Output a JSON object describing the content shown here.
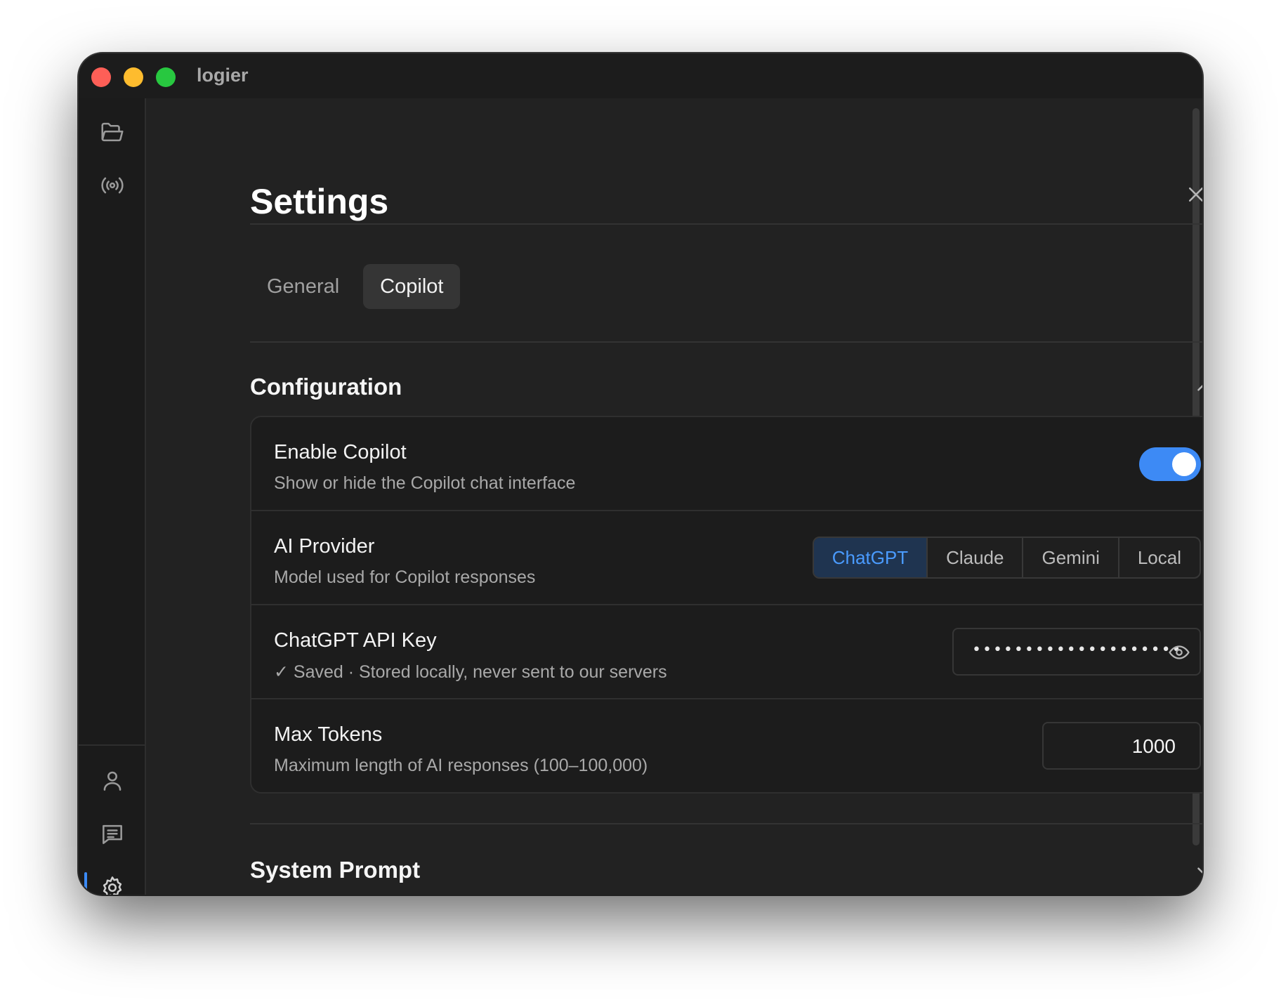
{
  "window": {
    "title": "logier"
  },
  "sidebar": {
    "top_items": [
      {
        "icon": "folder-open-icon"
      },
      {
        "icon": "broadcast-icon"
      }
    ],
    "bottom_items": [
      {
        "icon": "user-icon"
      },
      {
        "icon": "message-icon"
      },
      {
        "icon": "gear-icon",
        "active": true
      }
    ]
  },
  "settings": {
    "title": "Settings",
    "tabs": [
      {
        "label": "General",
        "active": false
      },
      {
        "label": "Copilot",
        "active": true
      }
    ]
  },
  "configuration": {
    "title": "Configuration",
    "expanded": true,
    "enable_copilot": {
      "label": "Enable Copilot",
      "description": "Show or hide the Copilot chat interface",
      "enabled": true
    },
    "ai_provider": {
      "label": "AI Provider",
      "description": "Model used for Copilot responses",
      "options": [
        "ChatGPT",
        "Claude",
        "Gemini",
        "Local"
      ],
      "selected": "ChatGPT"
    },
    "api_key": {
      "label": "ChatGPT API Key",
      "description": "✓ Saved · Stored locally, never sent to our servers",
      "masked_value": "••••••••••••••••••••"
    },
    "max_tokens": {
      "label": "Max Tokens",
      "description": "Maximum length of AI responses (100–100,000)",
      "value": "1000"
    }
  },
  "system_prompt": {
    "title": "System Prompt",
    "expanded": false
  },
  "colors": {
    "accent": "#3d8af5",
    "window_bg": "#222222",
    "card_bg": "#1c1c1c"
  }
}
